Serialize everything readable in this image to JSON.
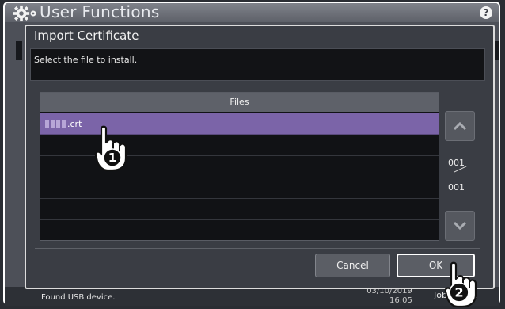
{
  "window": {
    "title": "User Functions"
  },
  "dialog": {
    "title": "Import Certificate",
    "message": "Select the file to install."
  },
  "file_list": {
    "header": "Files",
    "rows": [
      {
        "name": ".crt",
        "selected": true
      },
      {
        "name": "",
        "selected": false
      },
      {
        "name": "",
        "selected": false
      },
      {
        "name": "",
        "selected": false
      },
      {
        "name": "",
        "selected": false
      },
      {
        "name": "",
        "selected": false
      }
    ]
  },
  "pager": {
    "current": "001",
    "total": "001"
  },
  "buttons": {
    "cancel": "Cancel",
    "ok": "OK"
  },
  "status": {
    "message": "Found USB device.",
    "date": "03/10/2019",
    "time": "16:05",
    "job_status": "Job Status"
  },
  "annotations": {
    "step1": "1",
    "step2": "2"
  },
  "colors": {
    "selected_row": "#7b64a8",
    "background": "#2a2d33"
  }
}
